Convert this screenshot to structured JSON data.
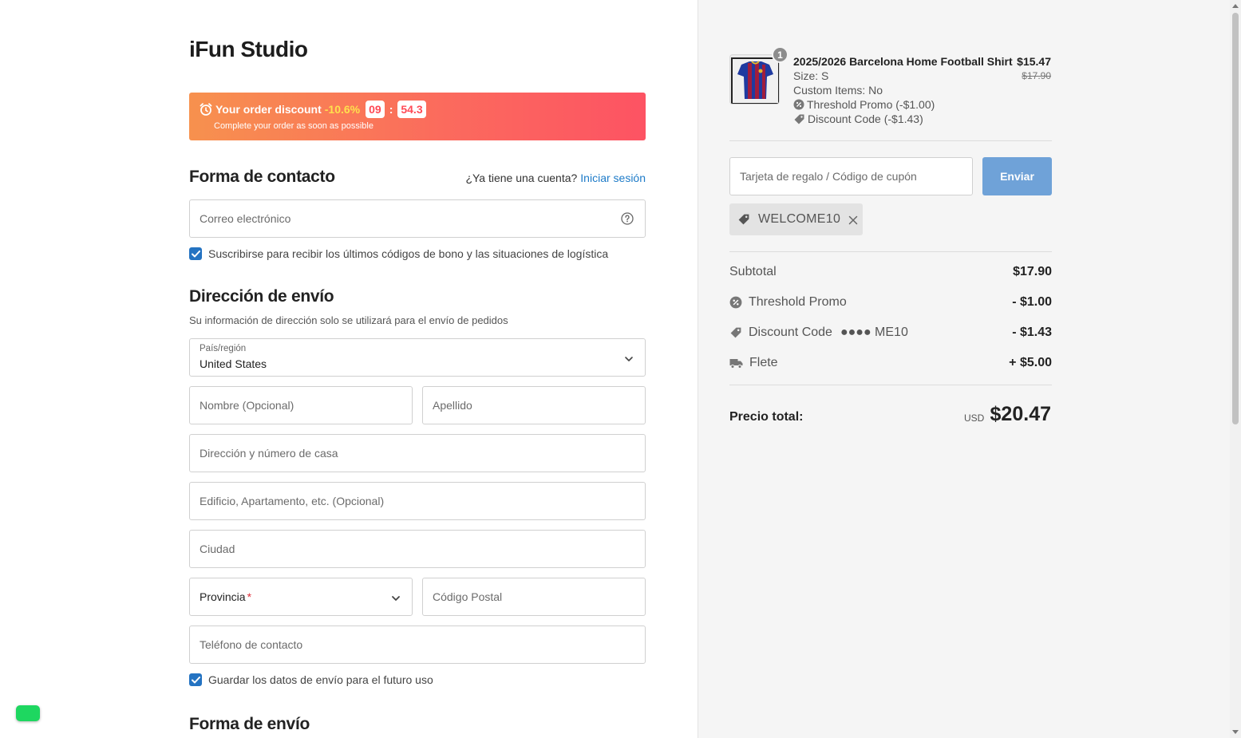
{
  "brand": "iFun Studio",
  "banner": {
    "label": "Your order discount",
    "discount": "-10.6%",
    "minutes": "09",
    "seconds": "54.3",
    "subtitle": "Complete your order as soon as possible"
  },
  "contact": {
    "title": "Forma de contacto",
    "account_prompt": "¿Ya tiene una cuenta?",
    "login_link": "Iniciar sesión",
    "email_placeholder": "Correo electrónico",
    "subscribe_label": "Suscribirse para recibir los últimos códigos de bono y las situaciones de logística",
    "subscribe_checked": true
  },
  "shipping_address": {
    "title": "Dirección de envío",
    "subtitle": "Su información de dirección solo se utilizará para el envío de pedidos",
    "country_label": "País/región",
    "country_value": "United States",
    "first_name_placeholder": "Nombre (Opcional)",
    "last_name_placeholder": "Apellido",
    "address_placeholder": "Dirección y número de casa",
    "address2_placeholder": "Edificio, Apartamento, etc. (Opcional)",
    "city_placeholder": "Ciudad",
    "province_label": "Provincia",
    "province_required_mark": "*",
    "postal_placeholder": "Código Postal",
    "phone_placeholder": "Teléfono de contacto",
    "save_label": "Guardar los datos de envío para el futuro uso",
    "save_checked": true
  },
  "shipping_method": {
    "title": "Forma de envío"
  },
  "cart": {
    "item": {
      "quantity": "1",
      "title": "2025/2026 Barcelona Home Football Shirt",
      "size": "Size: S",
      "custom": "Custom Items: No",
      "promo": "Threshold Promo (-$1.00)",
      "discount": "Discount Code (-$1.43)",
      "price": "$15.47",
      "original_price": "$17.90"
    },
    "coupon_placeholder": "Tarjeta de regalo / Código de cupón",
    "coupon_button": "Enviar",
    "applied_code": "WELCOME10"
  },
  "summary": {
    "subtotal_label": "Subtotal",
    "subtotal": "$17.90",
    "promo_label": "Threshold Promo",
    "promo_amount": "- $1.00",
    "discount_label": "Discount Code",
    "discount_masked": "●●●● ME10",
    "discount_amount": "- $1.43",
    "shipping_label": "Flete",
    "shipping_amount": "+ $5.00",
    "total_label": "Precio total:",
    "currency": "USD",
    "total": "$20.47"
  },
  "colors": {
    "accent_link": "#1e7bc8",
    "checkbox": "#2473c2",
    "coupon_button": "#6fa2d8",
    "banner_start": "#f7914e",
    "banner_end": "#fd5363",
    "chat_button": "#1ed760"
  }
}
